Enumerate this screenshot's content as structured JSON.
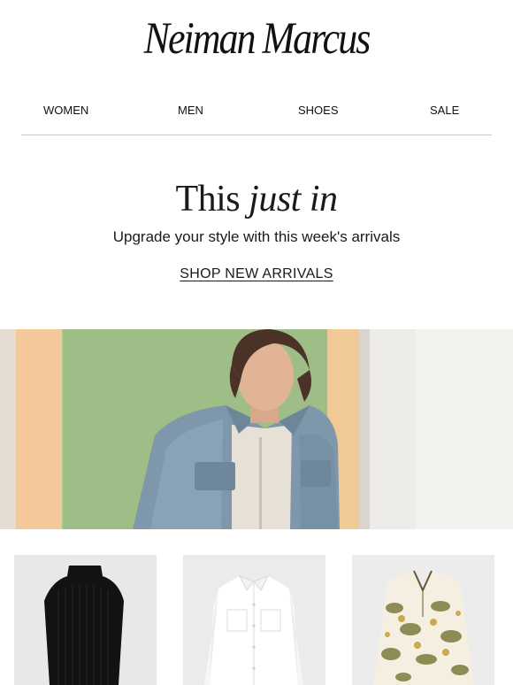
{
  "brand": {
    "logo_text": "Neiman Marcus"
  },
  "nav": {
    "items": [
      "WOMEN",
      "MEN",
      "SHOES",
      "SALE"
    ]
  },
  "hero": {
    "title_plain": "This",
    "title_italic": "just in",
    "subtitle": "Upgrade your style with this week's arrivals",
    "cta_label": "SHOP NEW ARRIVALS"
  },
  "products": [
    {
      "description": "black ribbed sleeveless mock-neck top"
    },
    {
      "description": "white button-front utility shirt"
    },
    {
      "description": "gold and white paisley print blouse"
    }
  ]
}
